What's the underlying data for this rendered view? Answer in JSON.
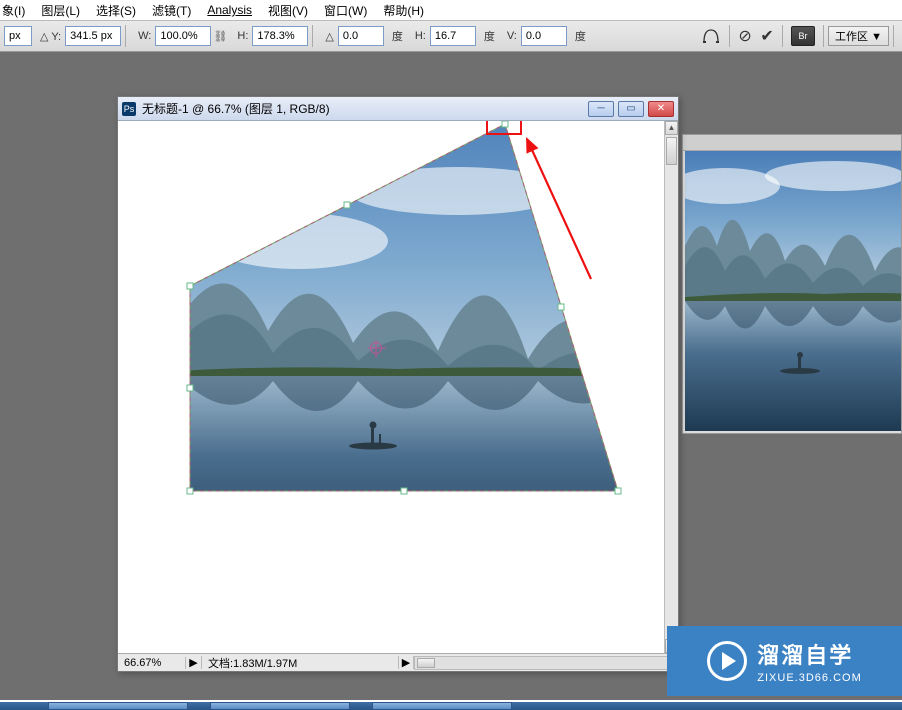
{
  "menu": {
    "image": "象(I)",
    "layer": "图层(L)",
    "select": "选择(S)",
    "filter": "滤镜(T)",
    "analysis": "Analysis",
    "view": "视图(V)",
    "window": "窗口(W)",
    "help": "帮助(H)"
  },
  "options": {
    "x_label": "px",
    "y_label": "Y:",
    "y_value": "341.5 px",
    "w_label": "W:",
    "w_value": "100.0%",
    "h_label": "H:",
    "h_value": "178.3%",
    "angle_label": "△",
    "angle_value": "0.0",
    "degree": "度",
    "h2_label": "H:",
    "h2_value": "16.7",
    "v_label": "V:",
    "v_value": "0.0",
    "workarea": "工作区 ▼",
    "br_label": "Br"
  },
  "doc": {
    "title": "无标题-1 @ 66.7% (图层 1, RGB/8)",
    "zoom": "66.67%",
    "info_label": "文档:",
    "info_value": "1.83M/1.97M"
  },
  "watermark": {
    "title": "溜溜自学",
    "url": "ZIXUE.3D66.COM"
  }
}
